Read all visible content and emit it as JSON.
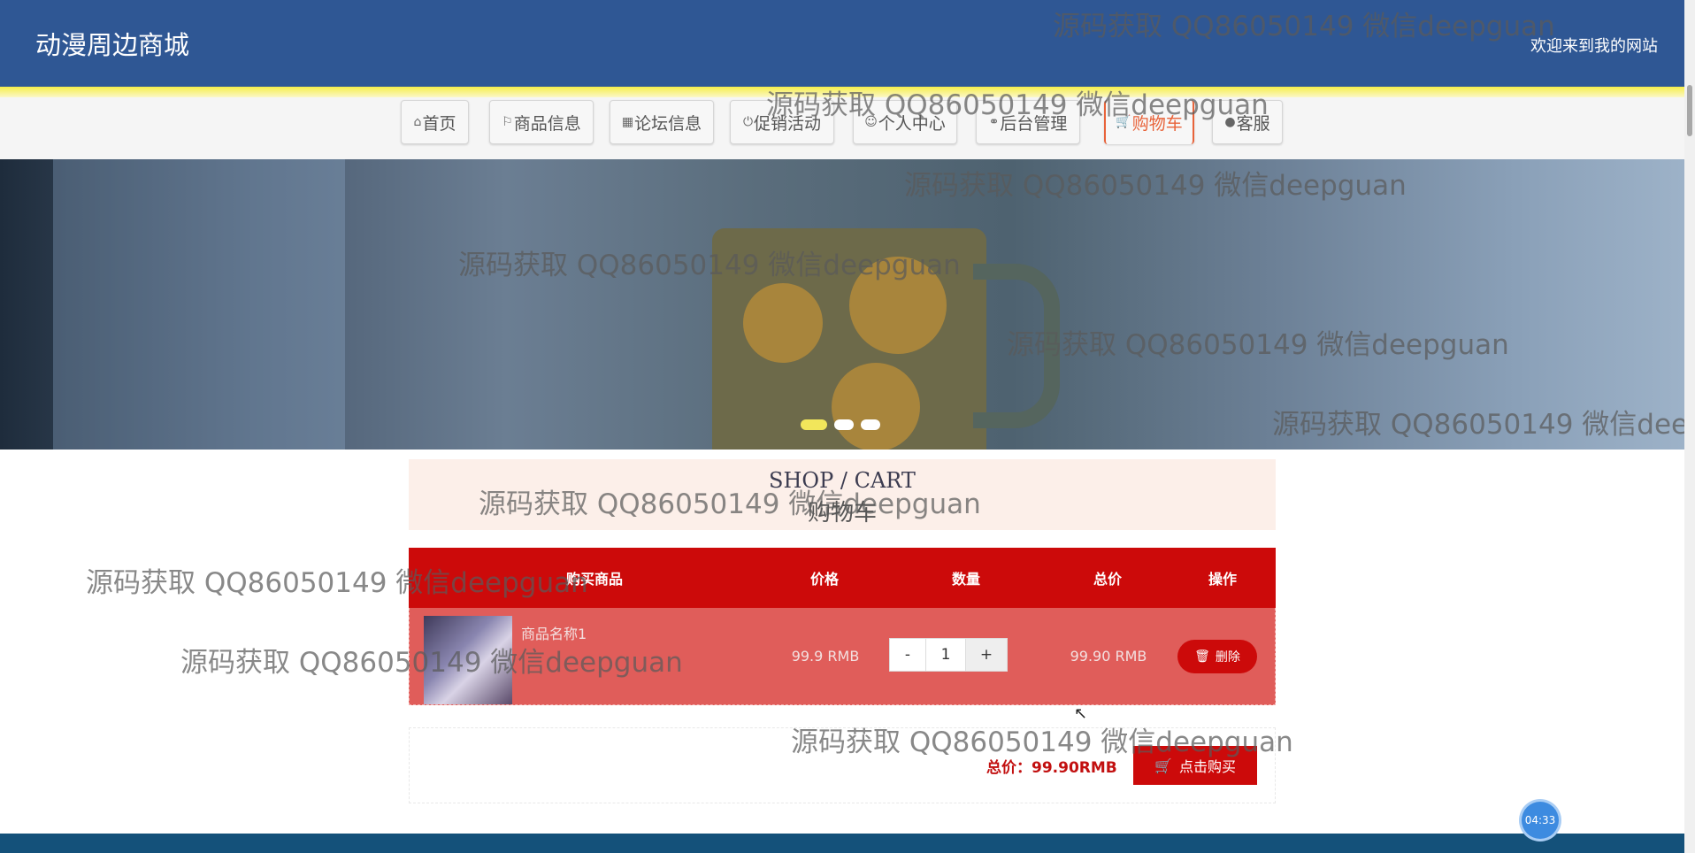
{
  "header": {
    "title": "动漫周边商城",
    "welcome": "欢迎来到我的网站"
  },
  "nav": {
    "items": [
      {
        "icon": "⌂",
        "label": "首页"
      },
      {
        "icon": "⚐",
        "label": "商品信息"
      },
      {
        "icon": "▦",
        "label": "论坛信息"
      },
      {
        "icon": "⏻",
        "label": "促销活动"
      },
      {
        "icon": "☺",
        "label": "个人中心"
      },
      {
        "icon": "⚭",
        "label": "后台管理"
      },
      {
        "icon": "🛒",
        "label": "购物车"
      },
      {
        "icon": "●",
        "label": "客服"
      }
    ],
    "active_index": 6
  },
  "cart": {
    "title_en": "SHOP / CART",
    "title_cn": "购物车",
    "columns": [
      "购买商品",
      "价格",
      "数量",
      "总价",
      "操作"
    ],
    "items": [
      {
        "name": "商品名称1",
        "price": "99.9 RMB",
        "quantity": "1",
        "minus": "-",
        "plus": "+",
        "subtotal": "99.90 RMB",
        "delete_label": "删除"
      }
    ],
    "total_label": "总价：99.90RMB",
    "buy_label": "点击购买"
  },
  "timer": "04:33",
  "watermark": "源码获取 QQ86050149 微信deepguan",
  "colors": {
    "header": "#2f5794",
    "table_head": "#cc0a0a",
    "table_row": "#e05d5a",
    "active_nav": "#e8633a"
  }
}
